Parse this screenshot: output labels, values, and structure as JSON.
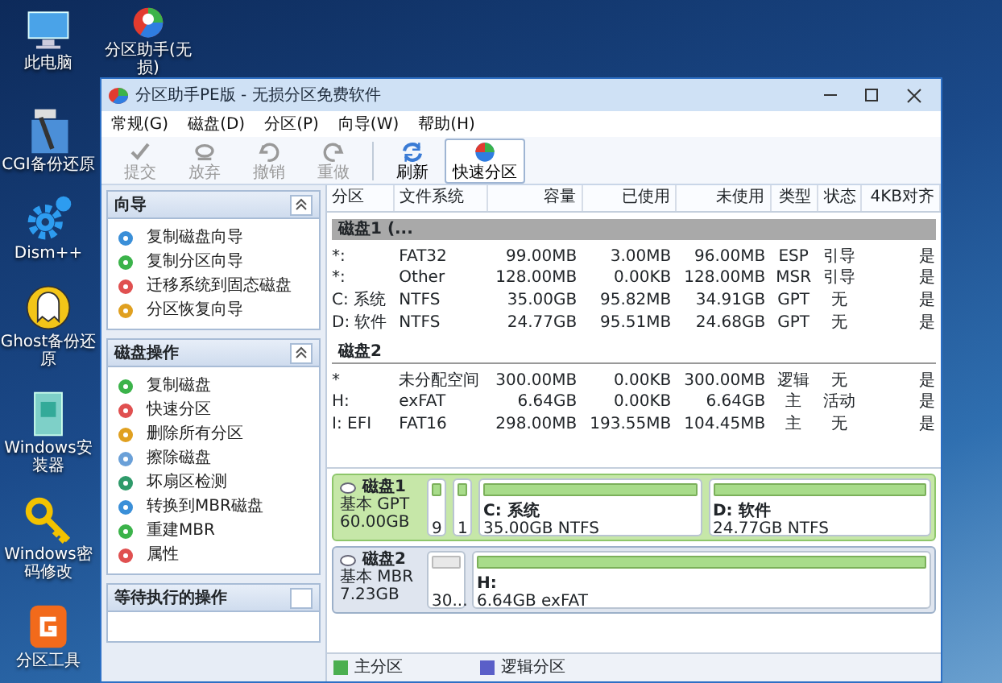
{
  "desktop_icons": [
    {
      "label": "此电脑",
      "kind": "computer"
    },
    {
      "label": "分区助手(无损)",
      "kind": "partition-app"
    },
    {
      "label": "CGI备份还原",
      "kind": "hammer"
    },
    {
      "label": "Dism++",
      "kind": "gear"
    },
    {
      "label": "Ghost备份还原",
      "kind": "ghost"
    },
    {
      "label": "Windows安装器",
      "kind": "installer"
    },
    {
      "label": "Windows密码修改",
      "kind": "key"
    },
    {
      "label": "分区工具",
      "kind": "partition-tool"
    }
  ],
  "window": {
    "title": "分区助手PE版 - 无损分区免费软件"
  },
  "menu": [
    "常规(G)",
    "磁盘(D)",
    "分区(P)",
    "向导(W)",
    "帮助(H)"
  ],
  "toolbar": [
    {
      "label": "提交",
      "kind": "submit",
      "disabled": true
    },
    {
      "label": "放弃",
      "kind": "discard",
      "disabled": true
    },
    {
      "label": "撤销",
      "kind": "undo",
      "disabled": true
    },
    {
      "label": "重做",
      "kind": "redo",
      "disabled": true
    },
    {
      "label": "刷新",
      "kind": "refresh",
      "disabled": false
    },
    {
      "label": "快速分区",
      "kind": "quick",
      "disabled": false
    }
  ],
  "sidebar": [
    {
      "title": "向导",
      "items": [
        "复制磁盘向导",
        "复制分区向导",
        "迁移系统到固态磁盘",
        "分区恢复向导"
      ]
    },
    {
      "title": "磁盘操作",
      "items": [
        "复制磁盘",
        "快速分区",
        "删除所有分区",
        "擦除磁盘",
        "坏扇区检测",
        "转换到MBR磁盘",
        "重建MBR",
        "属性"
      ]
    },
    {
      "title": "等待执行的操作"
    }
  ],
  "table": {
    "columns": [
      "分区",
      "文件系统",
      "容量",
      "已使用",
      "未使用",
      "类型",
      "状态",
      "4KB对齐"
    ],
    "groups": [
      {
        "name": "磁盘1 (...",
        "selected": true,
        "rows": [
          [
            "*:",
            "FAT32",
            "99.00MB",
            "3.00MB",
            "96.00MB",
            "ESP",
            "引导",
            "是"
          ],
          [
            "*:",
            "Other",
            "128.00MB",
            "0.00KB",
            "128.00MB",
            "MSR",
            "引导",
            "是"
          ],
          [
            "C: 系统",
            "NTFS",
            "35.00GB",
            "95.82MB",
            "34.91GB",
            "GPT",
            "无",
            "是"
          ],
          [
            "D: 软件",
            "NTFS",
            "24.77GB",
            "95.51MB",
            "24.68GB",
            "GPT",
            "无",
            "是"
          ]
        ]
      },
      {
        "name": "磁盘2",
        "selected": false,
        "rows": [
          [
            "*",
            "未分配空间",
            "300.00MB",
            "0.00KB",
            "300.00MB",
            "逻辑",
            "无",
            "是"
          ],
          [
            "H:",
            "exFAT",
            "6.64GB",
            "0.00KB",
            "6.64GB",
            "主",
            "活动",
            "是"
          ],
          [
            "I: EFI",
            "FAT16",
            "298.00MB",
            "193.55MB",
            "104.45MB",
            "主",
            "无",
            "是"
          ]
        ]
      }
    ]
  },
  "disk_map": [
    {
      "name": "磁盘1",
      "type": "基本 GPT",
      "size": "60.00GB",
      "selected": true,
      "partitions": [
        {
          "kind": "primary",
          "size": "9"
        },
        {
          "kind": "primary",
          "size": "1"
        },
        {
          "kind": "primary",
          "name": "C: 系统",
          "size": "35.00GB NTFS"
        },
        {
          "kind": "primary",
          "name": "D: 软件",
          "size": "24.77GB NTFS"
        }
      ]
    },
    {
      "name": "磁盘2",
      "type": "基本 MBR",
      "size": "7.23GB",
      "selected": false,
      "partitions": [
        {
          "kind": "unallocated",
          "size": "30..."
        },
        {
          "kind": "primary",
          "name": "H:",
          "size": "6.64GB exFAT"
        }
      ]
    }
  ],
  "legend": [
    {
      "label": "主分区",
      "color": "#4caf50"
    },
    {
      "label": "逻辑分区",
      "color": "#5a5fc8"
    }
  ]
}
